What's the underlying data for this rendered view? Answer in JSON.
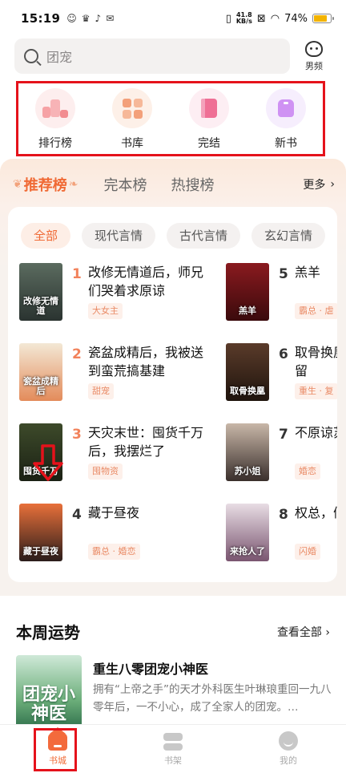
{
  "status_bar": {
    "time": "15:19",
    "net_speed_value": "41.8",
    "net_speed_unit": "KB/s",
    "battery": "74%"
  },
  "search": {
    "placeholder": "团宠"
  },
  "gender_switch": {
    "label": "男频"
  },
  "quick_nav": [
    {
      "label": "排行榜",
      "icon": "ranking-icon"
    },
    {
      "label": "书库",
      "icon": "library-grid-icon"
    },
    {
      "label": "完结",
      "icon": "book-icon"
    },
    {
      "label": "新书",
      "icon": "new-tag-icon"
    }
  ],
  "rank": {
    "tabs": [
      "推荐榜",
      "完本榜",
      "热搜榜"
    ],
    "active_tab": "推荐榜",
    "more": "更多",
    "chips": [
      "全部",
      "现代言情",
      "古代言情",
      "玄幻言情"
    ],
    "active_chip": "全部",
    "books": [
      {
        "num": "1",
        "title": "改修无情道后，师兄们哭着求原谅",
        "tag": "大女主",
        "cover_text": "改修无情道",
        "cover_colors": [
          "#5b6b5f",
          "#2a3330"
        ]
      },
      {
        "num": "2",
        "title": "瓷盆成精后，我被送到蛮荒搞基建",
        "tag": "甜宠",
        "cover_text": "瓷盆成精后",
        "cover_colors": [
          "#f3e8d5",
          "#e38b5a"
        ]
      },
      {
        "num": "3",
        "title": "天灾末世：囤货千万后，我摆烂了",
        "tag": "囤物资",
        "cover_text": "囤货千万",
        "cover_colors": [
          "#3d4a2a",
          "#1b2114"
        ]
      },
      {
        "num": "4",
        "title": "藏于昼夜",
        "tag": "霸总 · 婚恋",
        "cover_text": "藏于昼夜",
        "cover_colors": [
          "#e8703a",
          "#2b1d1b"
        ]
      },
      {
        "num": "5",
        "title": "羔羊",
        "tag": "霸总 · 虐",
        "cover_text": "羔羊",
        "cover_colors": [
          "#8a1a1f",
          "#3a0a0c"
        ]
      },
      {
        "num": "6",
        "title": "取骨换凰命你留",
        "tag": "重生 · 复",
        "cover_text": "取骨换凰",
        "cover_colors": [
          "#5a3b2a",
          "#1f140d"
        ]
      },
      {
        "num": "7",
        "title": "不原谅苏小姐",
        "tag": "婚恋",
        "cover_text": "苏小姐",
        "cover_colors": [
          "#c8b7a8",
          "#3a2f2c"
        ]
      },
      {
        "num": "8",
        "title": "权总，们来抢",
        "tag": "闪婚",
        "cover_text": "来抢人了",
        "cover_colors": [
          "#e8dde4",
          "#7a5570"
        ]
      }
    ]
  },
  "weekly": {
    "title": "本周运势",
    "more": "查看全部",
    "book_title": "重生八零团宠小神医",
    "book_desc": "拥有“上帝之手”的天才外科医生叶琳琅重回一九八零年后，一不小心，成了全家人的团宠。…",
    "cover_text": "团宠小神医"
  },
  "bottom_nav": [
    {
      "label": "书城",
      "icon": "home-icon",
      "active": true
    },
    {
      "label": "书架",
      "icon": "shelf-icon",
      "active": false
    },
    {
      "label": "我的",
      "icon": "profile-icon",
      "active": false
    }
  ],
  "colors": {
    "accent": "#f06a35",
    "highlight_box": "#e5121b"
  }
}
